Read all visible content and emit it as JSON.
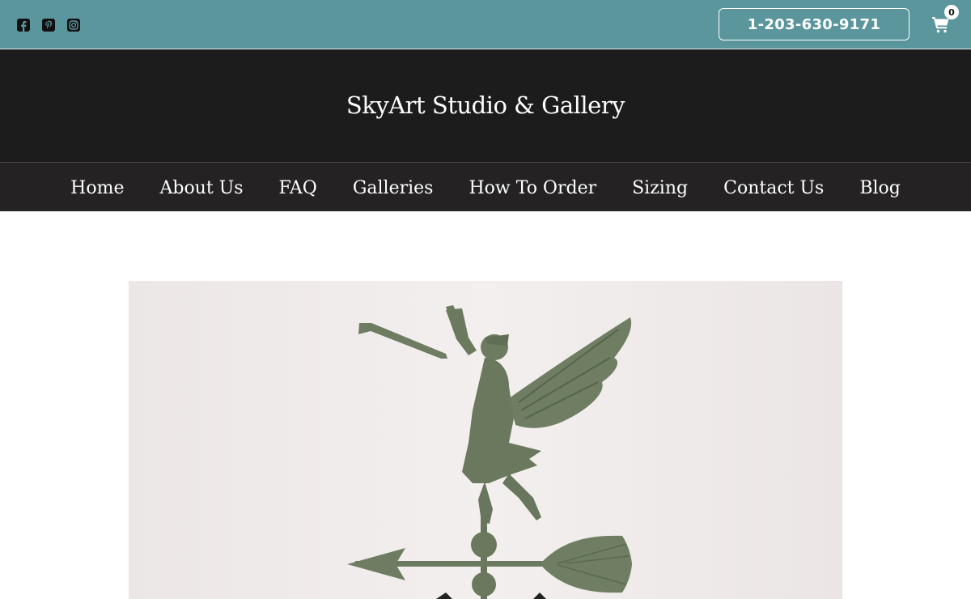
{
  "social": {
    "icons": [
      "facebook-icon",
      "pinterest-icon",
      "instagram-icon"
    ]
  },
  "header_bar": {
    "phone_label": "1-203-630-9171",
    "cart_count": "0",
    "bar_color": "#5b969d"
  },
  "site": {
    "title": "SkyArt Studio & Gallery"
  },
  "nav": {
    "items": [
      {
        "label": "Home"
      },
      {
        "label": "About Us"
      },
      {
        "label": "FAQ"
      },
      {
        "label": "Galleries"
      },
      {
        "label": "How To Order"
      },
      {
        "label": "Sizing"
      },
      {
        "label": "Contact Us"
      },
      {
        "label": "Blog"
      }
    ]
  },
  "hero": {
    "image": "angel-weathervane-image",
    "figure_color": "#6e7d62"
  }
}
